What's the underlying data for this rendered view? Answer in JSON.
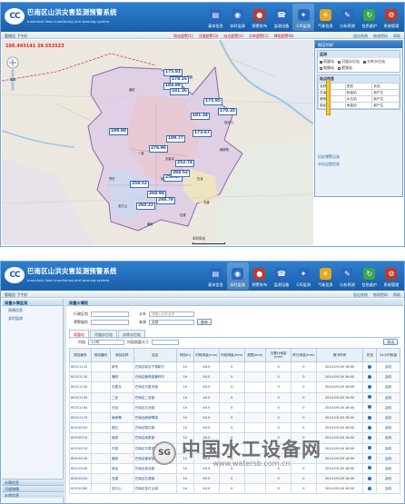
{
  "app": {
    "title_cn": "巴南区山洪灾害监测预警系统",
    "title_en": "mountain flood monitoring and warning system",
    "logo_text": "CC"
  },
  "nav": [
    {
      "label": "基本信息",
      "icon": "book-icon",
      "color": "#2a68c0"
    },
    {
      "label": "实时监测",
      "icon": "monitor-icon",
      "color": "#2a68c0"
    },
    {
      "label": "预警发布",
      "icon": "traffic-light-icon",
      "color": "#c0392b"
    },
    {
      "label": "监测设备",
      "icon": "phone-icon",
      "color": "#2a68c0"
    },
    {
      "label": "GIS监测",
      "icon": "satellite-icon",
      "color": "#2a68c0"
    },
    {
      "label": "气象信息",
      "icon": "weather-icon",
      "color": "#e6a61f"
    },
    {
      "label": "分析预测",
      "icon": "pencil-icon",
      "color": "#2a68c0"
    },
    {
      "label": "信息维护",
      "icon": "refresh-icon",
      "color": "#3aa74a"
    },
    {
      "label": "系统管理",
      "icon": "gear-icon",
      "color": "#c0392b"
    }
  ],
  "top": {
    "user": "管理员 下午好",
    "alerts": [
      "雨站超警(1)",
      "河道超警(3)",
      "站点超警(1)",
      "水库超警(1)",
      "降雨超警(8)"
    ],
    "links": [
      "退出系统",
      "修改密码",
      "帮助"
    ]
  },
  "map": {
    "coords": "106.443141  29.553523",
    "scale": "4000米",
    "markers": [
      "175.81",
      "178.16",
      "184.89",
      "181.36",
      "175.85",
      "170.35",
      "181.34",
      "276.96",
      "258.27",
      "252.74",
      "259.52",
      "268.94",
      "288.78",
      "260.22",
      "189.88",
      "173.67",
      "189.77",
      "284.52"
    ],
    "places": [
      "木洞镇",
      "南彭",
      "界石",
      "麻柳嘴",
      "石龙",
      "丰盛",
      "二圣",
      "姜家",
      "圣灯山",
      "接龙",
      "一品",
      "天星寺",
      "双河口",
      "东泉",
      "石滩"
    ]
  },
  "panel": {
    "title": "图层控制",
    "section1": "监测",
    "checks": [
      "雨量站",
      "河道水位站",
      "水库水位站",
      "图像站",
      "视频站"
    ],
    "section2": "站点信息",
    "table": [
      [
        "名称",
        "类型",
        "状态"
      ],
      [
        "花溪河",
        "雨量站",
        "新产生"
      ],
      [
        "鹿角河",
        "水位站",
        "新产生"
      ],
      [
        "惠民",
        "雨量站",
        "新产生"
      ]
    ],
    "links": [
      "历史预警记录",
      "水位过程信息"
    ]
  },
  "screen2": {
    "left_header": "雨量水情监测",
    "left_items": [
      "雨情信息",
      "实时监测"
    ],
    "left_accordions": [
      "水情信息",
      "河道墒情",
      "水库信息"
    ],
    "content_title": "雨量水情报",
    "form": {
      "row1_label": "行政区划",
      "row1_value": "",
      "row1_label2": "水系",
      "row1_value2": "请输入水系名称",
      "row2_label": "预警级别",
      "row2_value": "",
      "row2_label2": "来源",
      "row2_value2": "全部",
      "search": "查询"
    },
    "tabs": [
      "雨量站",
      "河道水位站",
      "水库水位站"
    ],
    "toolbar": {
      "time_label": "时段",
      "time_value": "1小时",
      "count_label": "时段雨量大于",
      "count_value": "",
      "btn": "导出"
    },
    "headers": [
      "测站编号",
      "测站编码",
      "测站名称",
      "站址",
      "时段(h)",
      "时段雨量(mm)",
      "时段雨量(mm)",
      "超限(mm)",
      "日累计雨量(mm)",
      "昨日雨量(mm)",
      "报汛时间",
      "在线",
      "24小时雨量"
    ],
    "rows": [
      [
        "60011120",
        "",
        "新安",
        "巴南区新店子镇新村",
        "1h",
        "40.0",
        "0",
        "",
        "0",
        "0",
        "2014-09-26 16:00",
        "●",
        "曲线"
      ],
      [
        "60011130",
        "",
        "兼林",
        "巴南区鹿角镇兼林村",
        "1h",
        "40.0",
        "0",
        "",
        "0",
        "0",
        "2014-09-26 16:00",
        "●",
        "曲线"
      ],
      [
        "60011140",
        "",
        "天星寺",
        "巴南区天星寺镇",
        "1h",
        "40.0",
        "0",
        "",
        "0",
        "0",
        "2014-09-26 16:00",
        "●",
        "曲线"
      ],
      [
        "60011150",
        "",
        "二圣",
        "巴南区二圣镇",
        "1h",
        "40.0",
        "0",
        "",
        "0",
        "0",
        "2014-09-26 16:00",
        "●",
        "曲线"
      ],
      [
        "60011160",
        "",
        "石龙",
        "巴南区石龙镇",
        "1h",
        "40.0",
        "0",
        "",
        "0",
        "0",
        "2014-09-26 16:00",
        "●",
        "曲线"
      ],
      [
        "60011170",
        "",
        "麻柳嘴",
        "巴南区麻柳嘴镇",
        "1h",
        "40.0",
        "0",
        "",
        "0",
        "0",
        "2014-09-26 16:00",
        "●",
        "曲线"
      ],
      [
        "60010200",
        "",
        "跳石",
        "巴南区跳石镇",
        "1h",
        "40.0",
        "0",
        "",
        "0",
        "0",
        "2014-09-26 16:00",
        "●",
        "曲线"
      ],
      [
        "60010210",
        "",
        "南泉",
        "巴南区南泉镇",
        "1h",
        "40.0",
        "0",
        "",
        "0",
        "0",
        "2014-09-26 16:00",
        "●",
        "曲线"
      ],
      [
        "60010220",
        "",
        "东泉",
        "巴南区东泉镇",
        "1h",
        "40.0",
        "0",
        "",
        "0",
        "0",
        "2014-09-26 16:00",
        "●",
        "曲线"
      ],
      [
        "60010230",
        "",
        "姜家",
        "巴南区姜家镇",
        "1h",
        "40.0",
        "0",
        "",
        "0",
        "0",
        "2014-09-26 16:00",
        "●",
        "曲线"
      ],
      [
        "60010240",
        "",
        "接龙",
        "巴南区接龙镇",
        "1h",
        "40.0",
        "0",
        "",
        "0",
        "0",
        "2014-09-26 16:00",
        "●",
        "曲线"
      ],
      [
        "60010250",
        "",
        "石滩",
        "巴南区石滩镇",
        "1h",
        "40.0",
        "0",
        "",
        "0",
        "0",
        "2014-09-26 16:00",
        "●",
        "曲线"
      ],
      [
        "60010260",
        "",
        "圣灯山",
        "巴南区圣灯山镇",
        "1h",
        "40.0",
        "0",
        "",
        "0",
        "0",
        "2014-09-26 16:00",
        "●",
        "曲线"
      ]
    ]
  },
  "watermark": {
    "text": "中国水工设备网",
    "url": "www.watersb.com.cn",
    "badge": "SG"
  }
}
